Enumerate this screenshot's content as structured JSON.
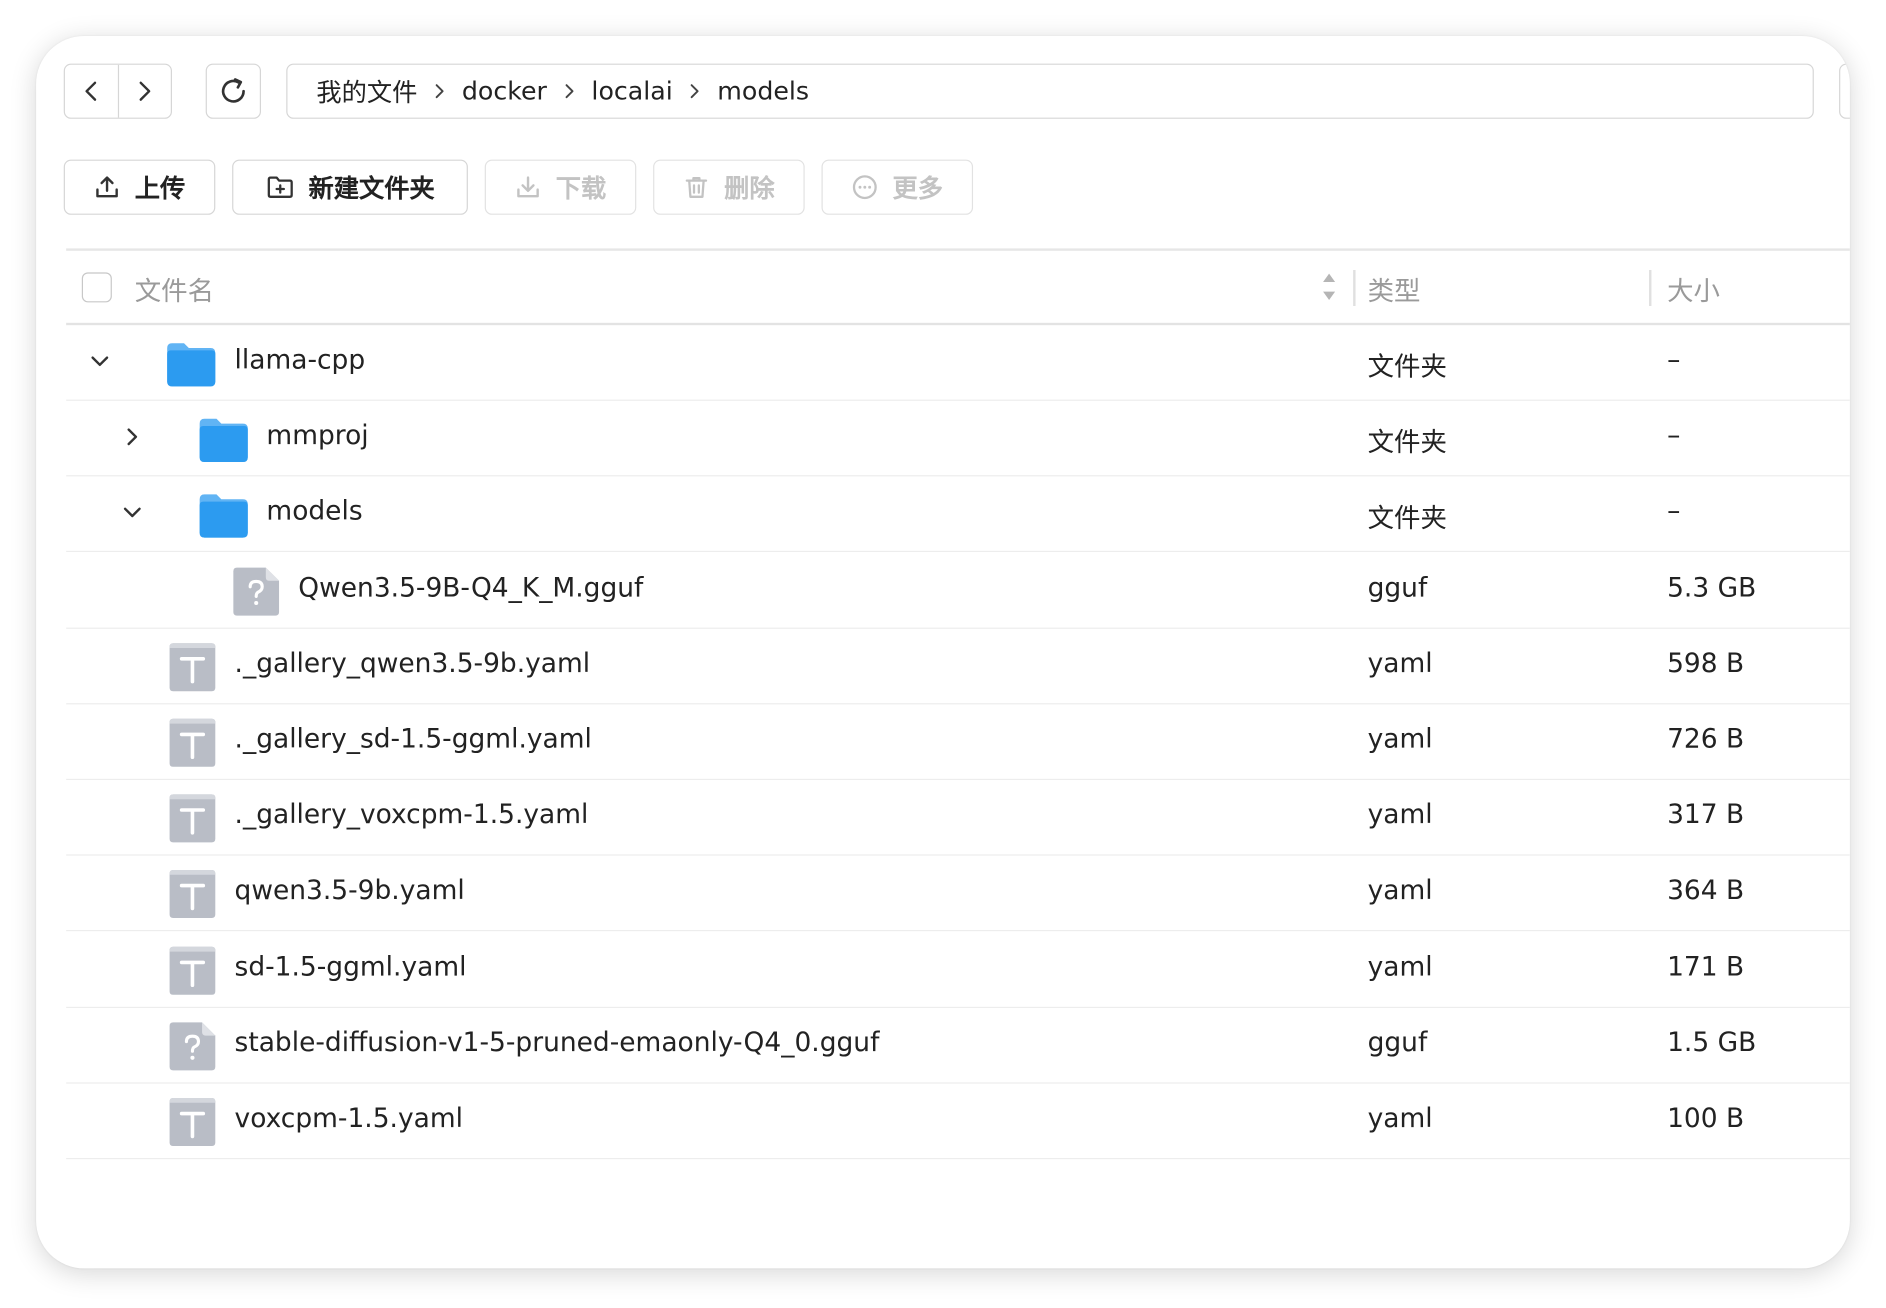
{
  "breadcrumb": [
    "我的文件",
    "docker",
    "localai",
    "models"
  ],
  "actions": {
    "upload": "上传",
    "new_folder": "新建文件夹",
    "download": "下载",
    "delete": "删除",
    "more": "更多"
  },
  "columns": {
    "name": "文件名",
    "type": "类型",
    "size": "大小"
  },
  "rows": [
    {
      "name": "llama-cpp",
      "type": "文件夹",
      "size": "–",
      "kind": "folder",
      "depth": 0,
      "toggle": "expanded"
    },
    {
      "name": "mmproj",
      "type": "文件夹",
      "size": "–",
      "kind": "folder",
      "depth": 1,
      "toggle": "collapsed"
    },
    {
      "name": "models",
      "type": "文件夹",
      "size": "–",
      "kind": "folder",
      "depth": 1,
      "toggle": "expanded"
    },
    {
      "name": "Qwen3.5-9B-Q4_K_M.gguf",
      "type": "gguf",
      "size": "5.3 GB",
      "kind": "unknown",
      "depth": 2,
      "toggle": "none"
    },
    {
      "name": "._gallery_qwen3.5-9b.yaml",
      "type": "yaml",
      "size": "598 B",
      "kind": "text",
      "depth": 0,
      "toggle": "none"
    },
    {
      "name": "._gallery_sd-1.5-ggml.yaml",
      "type": "yaml",
      "size": "726 B",
      "kind": "text",
      "depth": 0,
      "toggle": "none"
    },
    {
      "name": "._gallery_voxcpm-1.5.yaml",
      "type": "yaml",
      "size": "317 B",
      "kind": "text",
      "depth": 0,
      "toggle": "none"
    },
    {
      "name": "qwen3.5-9b.yaml",
      "type": "yaml",
      "size": "364 B",
      "kind": "text",
      "depth": 0,
      "toggle": "none"
    },
    {
      "name": "sd-1.5-ggml.yaml",
      "type": "yaml",
      "size": "171 B",
      "kind": "text",
      "depth": 0,
      "toggle": "none"
    },
    {
      "name": "stable-diffusion-v1-5-pruned-emaonly-Q4_0.gguf",
      "type": "gguf",
      "size": "1.5 GB",
      "kind": "unknown",
      "depth": 0,
      "toggle": "none"
    },
    {
      "name": "voxcpm-1.5.yaml",
      "type": "yaml",
      "size": "100 B",
      "kind": "text",
      "depth": 0,
      "toggle": "none"
    }
  ],
  "colors": {
    "folder": "#2c9bf0",
    "file_icon": "#b9bdc6",
    "border": "#d6d6d6",
    "disabled_text": "#c3c3c3"
  },
  "icons": {
    "nav": [
      "chevron-left-icon",
      "chevron-right-icon",
      "refresh-icon"
    ],
    "actions": [
      "upload-icon",
      "new-folder-icon",
      "download-icon",
      "trash-icon",
      "more-icon"
    ],
    "file_kinds": {
      "folder": "folder-icon",
      "text": "text-file-icon",
      "unknown": "unknown-file-icon"
    }
  }
}
